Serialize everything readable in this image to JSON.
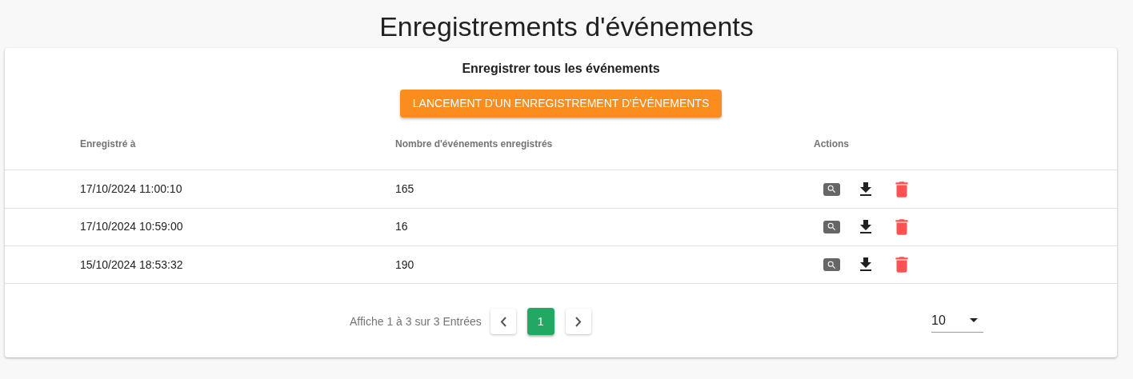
{
  "title": "Enregistrements d'événements",
  "section_title": "Enregistrer tous les événements",
  "launch_button": "LANCEMENT D'UN ENREGISTREMENT D'ÉVÉNEMENTS",
  "table": {
    "columns": [
      "Enregistré à",
      "Nombre d'événements enregistrés",
      "Actions"
    ],
    "rows": [
      {
        "recorded_at": "17/10/2024 11:00:10",
        "count": "165"
      },
      {
        "recorded_at": "17/10/2024 10:59:00",
        "count": "16"
      },
      {
        "recorded_at": "15/10/2024 18:53:32",
        "count": "190"
      }
    ]
  },
  "pagination": {
    "summary": "Affiche 1 à 3 sur 3 Entrées",
    "pages": [
      {
        "label": "1",
        "selected": true
      }
    ],
    "page_size": "10"
  }
}
